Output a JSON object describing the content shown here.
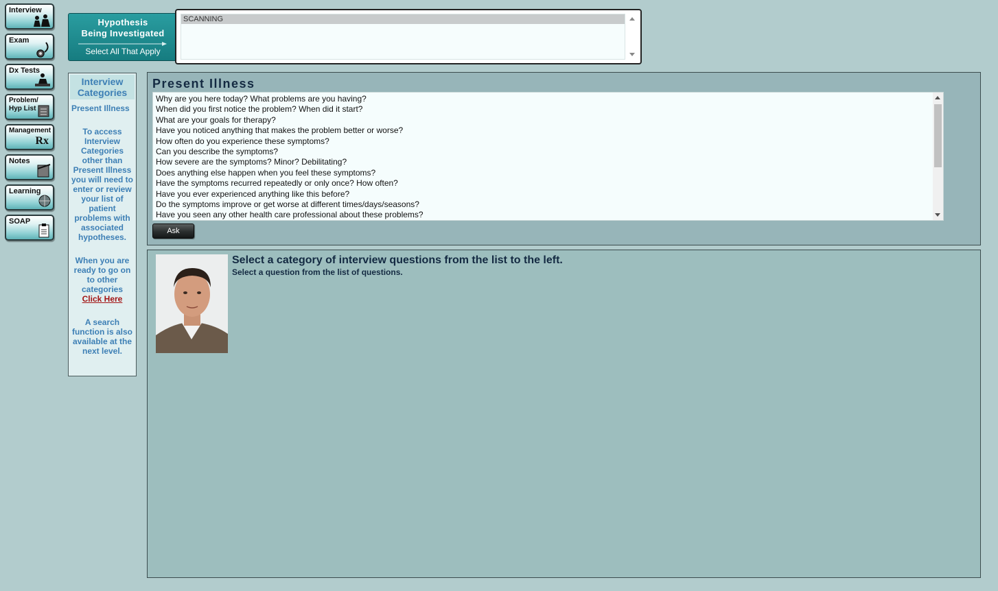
{
  "nav": {
    "items": [
      {
        "label": "Interview",
        "icon": "interview-icon"
      },
      {
        "label": "Exam",
        "icon": "stethoscope-icon"
      },
      {
        "label": "Dx Tests",
        "icon": "microscope-icon"
      },
      {
        "label": "Problem/\nHyp List",
        "icon": "checklist-icon"
      },
      {
        "label": "Management",
        "icon": "rx-icon",
        "icon_text": "Rx"
      },
      {
        "label": "Notes",
        "icon": "notepad-icon"
      },
      {
        "label": "Learning",
        "icon": "globe-icon"
      },
      {
        "label": "SOAP",
        "icon": "clipboard-icon"
      }
    ]
  },
  "hypothesis": {
    "title_line1": "Hypothesis",
    "title_line2": "Being Investigated",
    "subtitle": "Select All That Apply",
    "options": [
      "SCANNING"
    ]
  },
  "categories": {
    "heading": "Interview Categories",
    "items": [
      "Present Illness"
    ],
    "instructions": "To access Interview Categories other than Present Illness you will need to enter or review your list of patient problems with associated hypotheses.",
    "next_text": "When you are ready to go on to other categories",
    "link_label": "Click Here",
    "search_note": "A search function is also available at the next level."
  },
  "present_illness": {
    "title": "Present Illness",
    "questions": [
      "Why are you here today? What problems are you having?",
      "When did you first notice the problem? When did it start?",
      "What are your goals for therapy?",
      "Have you noticed anything that makes the problem better or worse?",
      "How often do you experience these symptoms?",
      "Can you describe the symptoms?",
      "How severe are the symptoms? Minor? Debilitating?",
      "Does anything else happen when you feel these symptoms?",
      "Have the symptoms recurred repeatedly or only once? How often?",
      "Have you ever experienced anything like this before?",
      "Do the symptoms improve or get worse at different times/days/seasons?",
      "Have you seen any other health care professional about these problems?"
    ],
    "ask_label": "Ask"
  },
  "response": {
    "heading": "Select a category of interview questions from the list to the left.",
    "subheading": "Select a question from the list of questions."
  }
}
